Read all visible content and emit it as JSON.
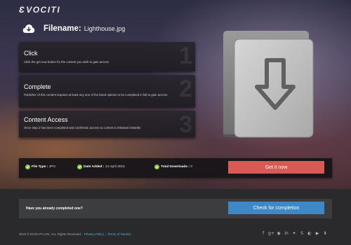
{
  "brand": {
    "logo_text": "VOCITI"
  },
  "file": {
    "label": "Filename:",
    "name": "Lighthouse.jpg"
  },
  "steps": [
    {
      "number": "1",
      "title": "Click",
      "description": "Click the get now button for the content you wish to gain access"
    },
    {
      "number": "2",
      "title": "Complete",
      "description": "Publisher of this content requires at least any one of the listed options to be completed in full to gain access."
    },
    {
      "number": "3",
      "title": "Content Access",
      "description": "Once step 2 has been completed and confirmed, access to content is released instantly"
    }
  ],
  "info": {
    "file_type_label": "File Type :",
    "file_type": "JPG",
    "date_added_label": "Date Added :",
    "date_added": "14 April 2015",
    "downloads_label": "Total Downloads :",
    "downloads": "0",
    "get_button": "Get it now"
  },
  "completion": {
    "question": "Have you already completed one?",
    "button": "Check for completion"
  },
  "footer": {
    "copyright": "2015 © EVOCITI LTD. ALL Rights Reserved.",
    "privacy": "Privacy Policy",
    "separator": "|",
    "terms": "Terms of Service"
  },
  "social_icons": [
    {
      "name": "facebook-icon",
      "glyph": "f"
    },
    {
      "name": "google-plus-icon",
      "glyph": "g+"
    },
    {
      "name": "pinterest-icon",
      "glyph": "◉"
    },
    {
      "name": "linkedin-icon",
      "glyph": "in"
    },
    {
      "name": "twitter-icon",
      "glyph": "✦"
    },
    {
      "name": "skype-icon",
      "glyph": "S"
    },
    {
      "name": "github-icon",
      "glyph": "◐"
    },
    {
      "name": "youtube-icon",
      "glyph": "▶"
    },
    {
      "name": "download-icon",
      "glyph": "⬇"
    }
  ],
  "colors": {
    "get_button": "#d95a55",
    "check_button": "#3e88c8",
    "check_icon": "#8cc63f",
    "link": "#5eb0d6"
  }
}
